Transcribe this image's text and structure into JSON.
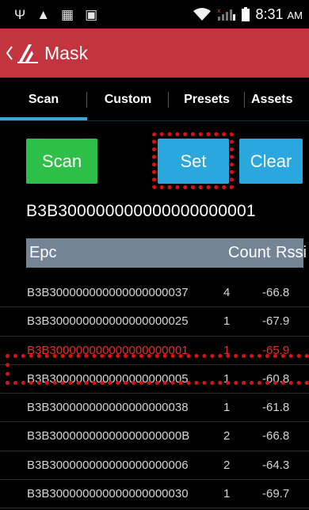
{
  "status_bar": {
    "icons": [
      "usb-icon",
      "warning-icon",
      "barcode-icon",
      "image-icon"
    ],
    "time": "8:31",
    "ampm": "AM"
  },
  "app_bar": {
    "title": "Mask"
  },
  "tabs": [
    {
      "label": "Scan",
      "active": true
    },
    {
      "label": "Custom",
      "active": false
    },
    {
      "label": "Presets",
      "active": false
    },
    {
      "label": "Assets",
      "active": false
    }
  ],
  "buttons": {
    "scan": "Scan",
    "set": "Set",
    "clear": "Clear"
  },
  "mask_value": "B3B300000000000000000001",
  "table": {
    "headers": {
      "epc": "Epc",
      "count": "Count",
      "rssi": "Rssi"
    },
    "rows": [
      {
        "epc": "B3B300000000000000000037",
        "count": "4",
        "rssi": "-66.8",
        "selected": false
      },
      {
        "epc": "B3B300000000000000000025",
        "count": "1",
        "rssi": "-67.9",
        "selected": false
      },
      {
        "epc": "B3B300000000000000000001",
        "count": "1",
        "rssi": "-65.9",
        "selected": true
      },
      {
        "epc": "B3B300000000000000000005",
        "count": "1",
        "rssi": "-60.8",
        "selected": false
      },
      {
        "epc": "B3B300000000000000000038",
        "count": "1",
        "rssi": "-61.8",
        "selected": false
      },
      {
        "epc": "B3B30000000000000000000B",
        "count": "2",
        "rssi": "-66.8",
        "selected": false
      },
      {
        "epc": "B3B300000000000000000006",
        "count": "2",
        "rssi": "-64.3",
        "selected": false
      },
      {
        "epc": "B3B300000000000000000030",
        "count": "1",
        "rssi": "-69.7",
        "selected": false
      }
    ]
  },
  "colors": {
    "app_bar": "#c2353e",
    "tab_indicator": "#34aadc",
    "scan_button": "#2ebf48",
    "action_button": "#2aa7dd",
    "table_header": "#728496",
    "highlight": "#dd1111",
    "selected_row_text": "#e62c2c"
  }
}
